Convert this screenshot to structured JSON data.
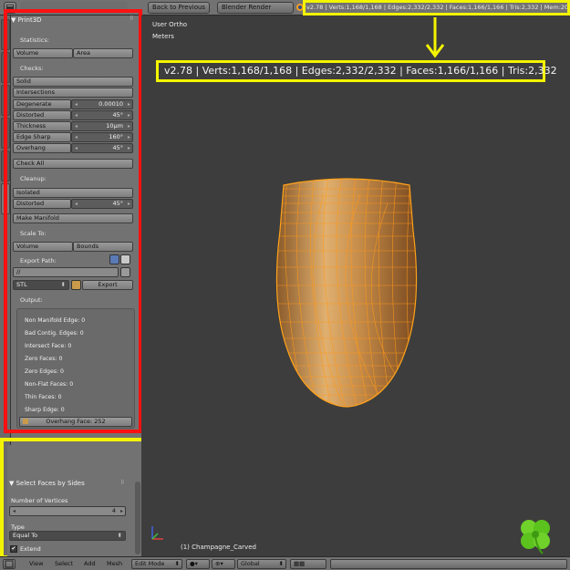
{
  "header": {
    "back_button": "Back to Previous",
    "render_engine": "Blender Render",
    "stats_small": "v2.78 | Verts:1,168/1,168 | Edges:2,332/2,332 | Faces:1,166/1,166 | Tris:2,332 | Mem:20"
  },
  "viewport": {
    "view_name": "User Ortho",
    "units": "Meters",
    "stats_big": "v2.78 | Verts:1,168/1,168 | Edges:2,332/2,332 | Faces:1,166/1,166 | Tris:2,332",
    "object_label": "(1) Champagne_Carved"
  },
  "print3d": {
    "title": "Print3D",
    "statistics_label": "Statistics:",
    "volume": "Volume",
    "area": "Area",
    "checks_label": "Checks:",
    "solid": "Solid",
    "intersections": "Intersections",
    "degenerate_label": "Degenerate",
    "degenerate_value": "0.00010",
    "distorted_label": "Distorted",
    "distorted_value": "45°",
    "thickness_label": "Thickness",
    "thickness_value": "10μm",
    "edge_sharp_label": "Edge Sharp",
    "edge_sharp_value": "160°",
    "overhang_label": "Overhang",
    "overhang_value": "45°",
    "check_all": "Check All",
    "cleanup_label": "Cleanup:",
    "isolated": "Isolated",
    "cleanup_distorted_label": "Distorted",
    "cleanup_distorted_value": "45°",
    "make_manifold": "Make Manifold",
    "scale_to_label": "Scale To:",
    "scale_volume": "Volume",
    "scale_bounds": "Bounds",
    "export_path_label": "Export Path:",
    "export_path_value": "//",
    "export_format": "STL",
    "export_button": "Export",
    "output_label": "Output:",
    "output_lines": [
      "Non Manifold Edge: 0",
      "Bad Contig. Edges: 0",
      "Intersect Face: 0",
      "Zero Faces: 0",
      "Zero Edges: 0",
      "Non-Flat Faces: 0",
      "Thin Faces: 0",
      "Sharp Edge: 0"
    ],
    "overhang_face_button": "Overhang Face: 252"
  },
  "operator": {
    "title": "Select Faces by Sides",
    "num_vertices_label": "Number of Vertices",
    "num_vertices_value": "4",
    "type_label": "Type",
    "type_value": "Equal To",
    "extend_label": "Extend"
  },
  "footer": {
    "view": "View",
    "select": "Select",
    "add": "Add",
    "mesh": "Mesh",
    "mode": "Edit Mode",
    "orientation": "Global"
  },
  "colors": {
    "highlight_red": "#ff1010",
    "highlight_yellow": "#f4f400",
    "mesh_wire": "#ff9a1a",
    "mesh_body": "#d9a15a"
  }
}
